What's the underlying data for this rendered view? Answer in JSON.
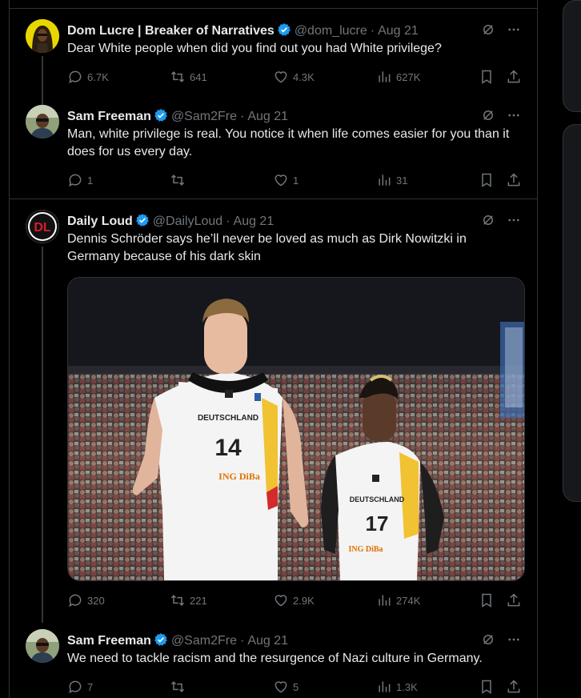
{
  "tweets": [
    {
      "name": "Dom Lucre | Breaker of Narratives",
      "handle": "@dom_lucre",
      "date": "Aug 21",
      "text": "Dear White people when did you find out you had White privilege?",
      "replies": "6.7K",
      "reposts": "641",
      "likes": "4.3K",
      "views": "627K"
    },
    {
      "name": "Sam Freeman",
      "handle": "@Sam2Fre",
      "date": "Aug 21",
      "text": "Man, white privilege is real. You notice it when life comes easier for you than it does for us every day.",
      "replies": "1",
      "reposts": "",
      "likes": "1",
      "views": "31"
    },
    {
      "name": "Daily Loud",
      "handle": "@DailyLoud",
      "date": "Aug 21",
      "text": "Dennis Schröder says he’ll never be loved as much as Dirk Nowitzki in Germany because of his dark skin",
      "replies": "320",
      "reposts": "221",
      "likes": "2.9K",
      "views": "274K",
      "media": {
        "jersey_left_text": "DEUTSCHLAND",
        "jersey_left_number": "14",
        "jersey_left_sponsor": "ING DiBa",
        "jersey_right_text": "DEUTSCHLAND",
        "jersey_right_number": "17",
        "jersey_right_sponsor": "ING DiBa"
      }
    },
    {
      "name": "Sam Freeman",
      "handle": "@Sam2Fre",
      "date": "Aug 21",
      "text": "We need to tackle racism and the resurgence of Nazi culture in Germany.",
      "replies": "7",
      "reposts": "",
      "likes": "5",
      "views": "1.3K"
    }
  ],
  "avatar_labels": {
    "daily_loud": "DL"
  },
  "colors": {
    "verified": "#1d9bf0",
    "text_secondary": "#71767b",
    "border": "#2f3336"
  }
}
